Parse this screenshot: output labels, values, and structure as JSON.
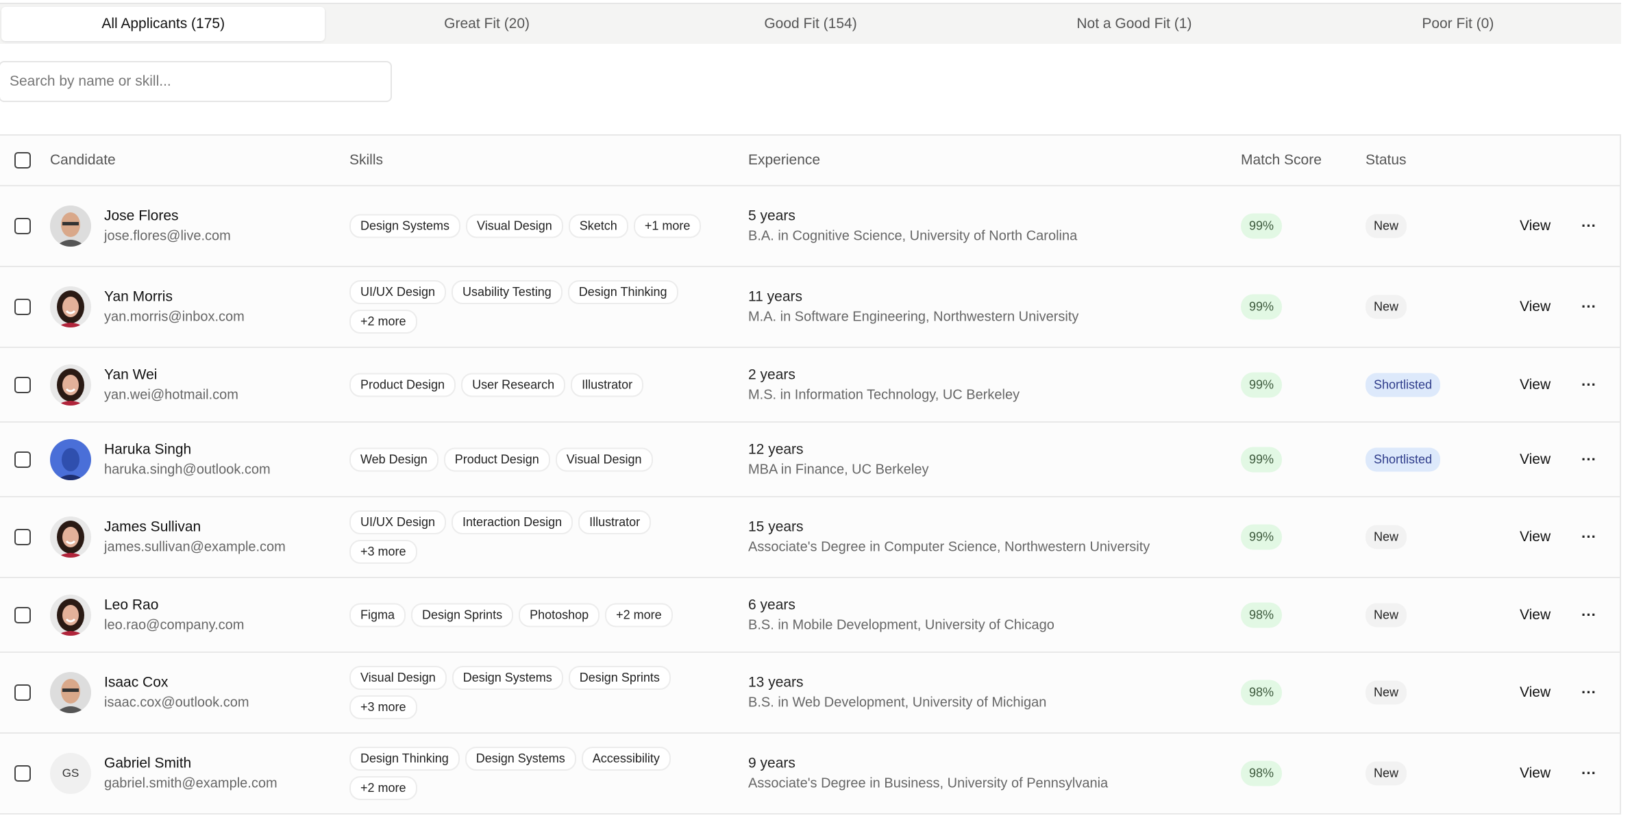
{
  "tabs": [
    {
      "label": "All Applicants (175)",
      "active": true
    },
    {
      "label": "Great Fit (20)"
    },
    {
      "label": "Good Fit (154)"
    },
    {
      "label": "Not a Good Fit (1)"
    },
    {
      "label": "Poor Fit (0)"
    }
  ],
  "search": {
    "placeholder": "Search by name or skill..."
  },
  "columns": {
    "candidate": "Candidate",
    "skills": "Skills",
    "experience": "Experience",
    "match": "Match Score",
    "status": "Status"
  },
  "view_label": "View",
  "more_icon": "ellipsis-icon",
  "colors": {
    "score_bg": "#e2f8e4",
    "new_bg": "#f2f2f2",
    "shortlisted_bg": "#dde9fb"
  },
  "rows": [
    {
      "name": "Jose Flores",
      "email": "jose.flores@live.com",
      "skills": [
        "Design Systems",
        "Visual Design",
        "Sketch",
        "+1 more"
      ],
      "years": "5 years",
      "degree": "B.A. in Cognitive Science, University of North Carolina",
      "score": "99%",
      "status": "New",
      "avatar": "photo-man"
    },
    {
      "name": "Yan Morris",
      "email": "yan.morris@inbox.com",
      "skills": [
        "UI/UX Design",
        "Usability Testing",
        "Design Thinking",
        "+2 more"
      ],
      "years": "11 years",
      "degree": "M.A. in Software Engineering, Northwestern University",
      "score": "99%",
      "status": "New",
      "avatar": "photo-woman"
    },
    {
      "name": "Yan Wei",
      "email": "yan.wei@hotmail.com",
      "skills": [
        "Product Design",
        "User Research",
        "Illustrator"
      ],
      "years": "2 years",
      "degree": "M.S. in Information Technology, UC Berkeley",
      "score": "99%",
      "status": "Shortlisted",
      "avatar": "photo-woman"
    },
    {
      "name": "Haruka Singh",
      "email": "haruka.singh@outlook.com",
      "skills": [
        "Web Design",
        "Product Design",
        "Visual Design"
      ],
      "years": "12 years",
      "degree": "MBA in Finance, UC Berkeley",
      "score": "99%",
      "status": "Shortlisted",
      "avatar": "photo-blue"
    },
    {
      "name": "James Sullivan",
      "email": "james.sullivan@example.com",
      "skills": [
        "UI/UX Design",
        "Interaction Design",
        "Illustrator",
        "+3 more"
      ],
      "years": "15 years",
      "degree": "Associate's Degree in Computer Science, Northwestern University",
      "score": "99%",
      "status": "New",
      "avatar": "photo-woman"
    },
    {
      "name": "Leo Rao",
      "email": "leo.rao@company.com",
      "skills": [
        "Figma",
        "Design Sprints",
        "Photoshop",
        "+2 more"
      ],
      "years": "6 years",
      "degree": "B.S. in Mobile Development, University of Chicago",
      "score": "98%",
      "status": "New",
      "avatar": "photo-woman"
    },
    {
      "name": "Isaac Cox",
      "email": "isaac.cox@outlook.com",
      "skills": [
        "Visual Design",
        "Design Systems",
        "Design Sprints",
        "+3 more"
      ],
      "years": "13 years",
      "degree": "B.S. in Web Development, University of Michigan",
      "score": "98%",
      "status": "New",
      "avatar": "photo-man"
    },
    {
      "name": "Gabriel Smith",
      "email": "gabriel.smith@example.com",
      "skills": [
        "Design Thinking",
        "Design Systems",
        "Accessibility",
        "+2 more"
      ],
      "years": "9 years",
      "degree": "Associate's Degree in Business, University of Pennsylvania",
      "score": "98%",
      "status": "New",
      "avatar": "GS"
    }
  ]
}
